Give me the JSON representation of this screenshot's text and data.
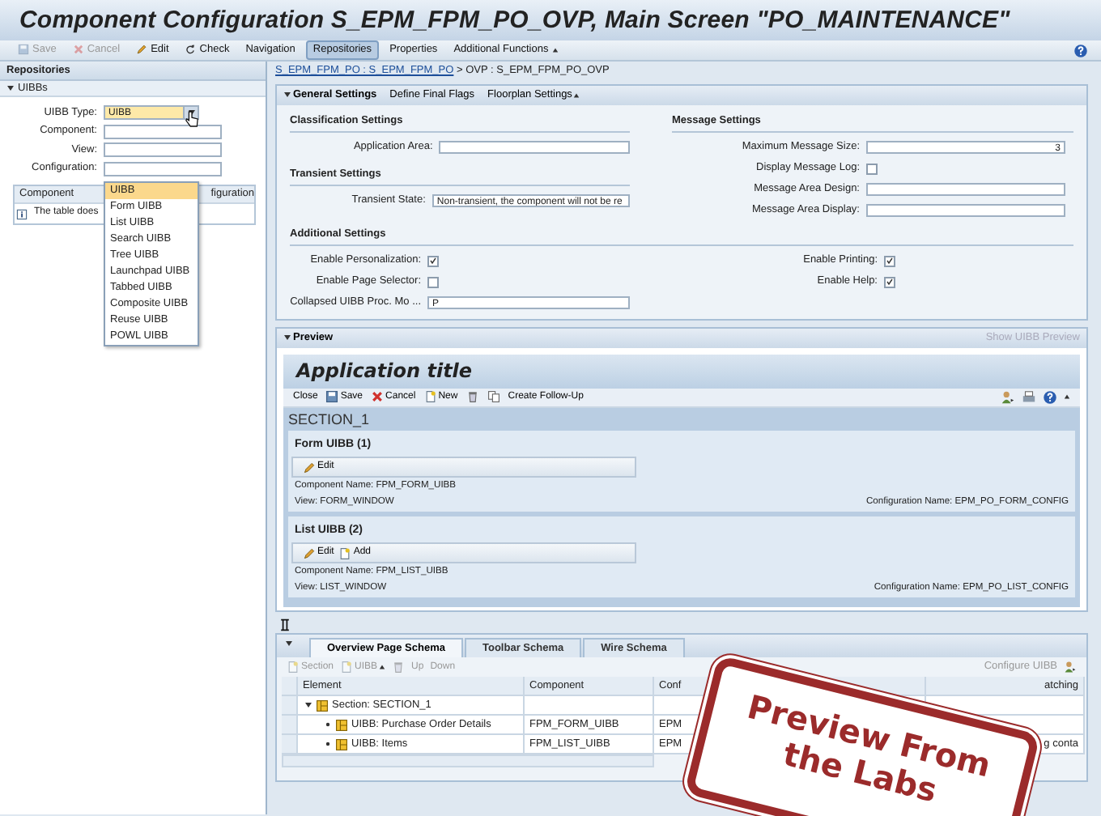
{
  "window": {
    "title": "Component Configuration S_EPM_FPM_PO_OVP, Main Screen \"PO_MAINTENANCE\""
  },
  "toolbar": [
    {
      "label": "Save",
      "disabled": true,
      "selected": false,
      "menu": false
    },
    {
      "label": "Cancel",
      "disabled": true,
      "selected": false,
      "menu": false
    },
    {
      "label": "Edit",
      "disabled": false,
      "selected": false,
      "menu": false
    },
    {
      "label": "Check",
      "disabled": false,
      "selected": false,
      "menu": false
    },
    {
      "label": "Navigation",
      "disabled": false,
      "selected": false,
      "menu": false
    },
    {
      "label": "Repositories",
      "disabled": false,
      "selected": true,
      "menu": false
    },
    {
      "label": "Properties",
      "disabled": false,
      "selected": false,
      "menu": false
    },
    {
      "label": "Additional Functions",
      "disabled": false,
      "selected": false,
      "menu": true
    }
  ],
  "repositories": {
    "title": "Repositories",
    "section": {
      "title": "UIBBs",
      "expanded": true
    },
    "fields": [
      {
        "label": "UIBB Type:",
        "kind": "dropdown",
        "value": "UIBB"
      },
      {
        "label": "Component:",
        "kind": "text"
      },
      {
        "label": "View:",
        "kind": "text"
      },
      {
        "label": "Configuration:",
        "kind": "text"
      }
    ],
    "table": {
      "columns": [
        "Component",
        "figuration"
      ],
      "message": "The table does"
    },
    "dropdown": {
      "items": [
        {
          "label": "UIBB",
          "selected": true
        },
        {
          "label": "Form UIBB",
          "selected": false
        },
        {
          "label": "List UIBB",
          "selected": false
        },
        {
          "label": "Search UIBB",
          "selected": false
        },
        {
          "label": "Tree UIBB",
          "selected": false
        },
        {
          "label": "Launchpad UIBB",
          "selected": false
        },
        {
          "label": "Tabbed UIBB",
          "selected": false
        },
        {
          "label": "Composite UIBB",
          "selected": false
        },
        {
          "label": "Reuse UIBB",
          "selected": false
        },
        {
          "label": "POWL UIBB",
          "selected": false
        }
      ]
    }
  },
  "breadcrumb": {
    "link": "S_EPM_FPM_PO : S_EPM_FPM_PO",
    "rest": "> OVP : S_EPM_FPM_PO_OVP"
  },
  "general_settings": {
    "title": "General Settings",
    "expanded": true,
    "actions": [
      {
        "label": "Define Final Flags",
        "menu": false
      },
      {
        "label": "Floorplan Settings",
        "menu": true
      }
    ],
    "left_groups": [
      {
        "title": "Classification Settings",
        "fields": [
          {
            "label": "Application Area:",
            "kind": "text"
          }
        ]
      },
      {
        "title": "Transient Settings",
        "fields": [
          {
            "label": "Transient State:",
            "kind": "text",
            "value": "Non-transient, the component will not be re"
          }
        ]
      }
    ],
    "right_groups": [
      {
        "title": "Message Settings",
        "fields": [
          {
            "label": "Maximum Message Size:",
            "kind": "number",
            "value": "3"
          },
          {
            "label": "Display Message Log:",
            "kind": "checkbox",
            "checked": false
          },
          {
            "label": "Message Area Design:",
            "kind": "text"
          },
          {
            "label": "Message Area Display:",
            "kind": "text"
          }
        ]
      }
    ],
    "additional": {
      "title": "Additional Settings",
      "left": [
        {
          "label": "Enable Personalization:",
          "kind": "checkbox",
          "checked": true
        },
        {
          "label": "Enable Page Selector:",
          "kind": "checkbox",
          "checked": false
        },
        {
          "label": "Collapsed UIBB Proc. Mo ...",
          "kind": "text",
          "value": "P"
        }
      ],
      "right": [
        {
          "label": "Enable Printing:",
          "kind": "checkbox",
          "checked": true
        },
        {
          "label": "Enable Help:",
          "kind": "checkbox",
          "checked": true
        }
      ]
    }
  },
  "preview": {
    "title": "Preview",
    "expanded": true,
    "action": "Show UIBB Preview",
    "app_title": "Application title",
    "toolbar": [
      {
        "label": "Close"
      },
      {
        "label": "Save"
      },
      {
        "label": "Cancel"
      },
      {
        "label": "New"
      },
      {
        "label": "Create Follow-Up"
      }
    ],
    "section": "SECTION_1",
    "uibbs": [
      {
        "title": "Form UIBB (1)",
        "buttons": [
          {
            "label": "Edit"
          }
        ],
        "component": "Component Name: FPM_FORM_UIBB",
        "view": "View: FORM_WINDOW",
        "configuration": "Configuration Name: EPM_PO_FORM_CONFIG"
      },
      {
        "title": "List UIBB (2)",
        "buttons": [
          {
            "label": "Edit"
          },
          {
            "label": "Add"
          }
        ],
        "component": "Component Name: FPM_LIST_UIBB",
        "view": "View: LIST_WINDOW",
        "configuration": "Configuration Name: EPM_PO_LIST_CONFIG"
      }
    ]
  },
  "schema": {
    "expanded": true,
    "tabs": [
      {
        "label": "Overview Page Schema",
        "selected": true
      },
      {
        "label": "Toolbar Schema",
        "selected": false
      },
      {
        "label": "Wire Schema",
        "selected": false
      }
    ],
    "toolbar": [
      {
        "label": "Section",
        "menu": false
      },
      {
        "label": "UIBB",
        "menu": true
      },
      {
        "label": "Up",
        "menu": false
      },
      {
        "label": "Down",
        "menu": false
      }
    ],
    "configure": "Configure UIBB",
    "table": {
      "columns": [
        "Element",
        "Component",
        "Conf",
        "atching"
      ],
      "rows": [
        {
          "element": "Section: SECTION_1",
          "expanded": true,
          "children": [
            {
              "element": "UIBB: Purchase Order Details",
              "component": "FPM_FORM_UIBB",
              "column_3": "EPM"
            },
            {
              "element": "UIBB: Items",
              "component": "FPM_LIST_UIBB",
              "column_3": "EPM",
              "column_4": "g conta"
            }
          ]
        }
      ]
    }
  },
  "stamp": {
    "text": "Preview From the Labs"
  }
}
